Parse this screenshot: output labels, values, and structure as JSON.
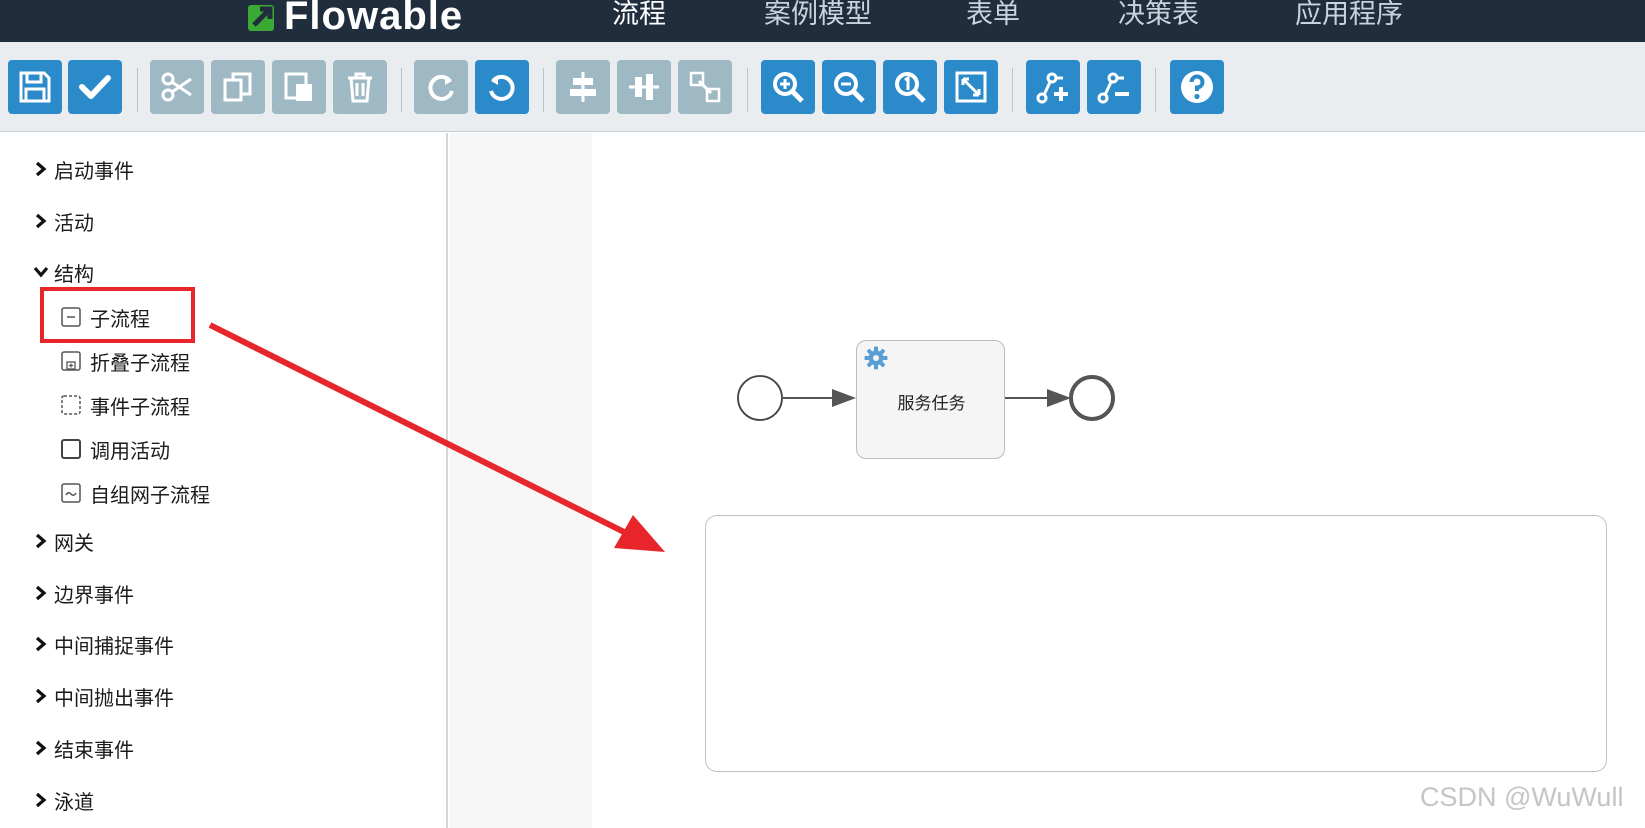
{
  "app": {
    "logo_text": "Flowable"
  },
  "nav": {
    "items": [
      {
        "label": "流程",
        "active": true
      },
      {
        "label": "案例模型",
        "active": false
      },
      {
        "label": "表单",
        "active": false
      },
      {
        "label": "决策表",
        "active": false
      },
      {
        "label": "应用程序",
        "active": false
      }
    ]
  },
  "toolbar": {
    "buttons": [
      {
        "icon": "save-icon",
        "enabled": true
      },
      {
        "icon": "check-icon",
        "enabled": true
      },
      {
        "icon": "cut-icon",
        "enabled": false
      },
      {
        "icon": "copy-icon",
        "enabled": false
      },
      {
        "icon": "paste-icon",
        "enabled": false
      },
      {
        "icon": "delete-icon",
        "enabled": false
      },
      {
        "icon": "redo-icon",
        "enabled": false
      },
      {
        "icon": "undo-icon",
        "enabled": true
      },
      {
        "icon": "align-horizontal-icon",
        "enabled": false
      },
      {
        "icon": "align-vertical-icon",
        "enabled": false
      },
      {
        "icon": "same-size-icon",
        "enabled": false
      },
      {
        "icon": "zoom-in-icon",
        "enabled": true
      },
      {
        "icon": "zoom-out-icon",
        "enabled": true
      },
      {
        "icon": "zoom-actual-icon",
        "enabled": true
      },
      {
        "icon": "zoom-fit-icon",
        "enabled": true
      },
      {
        "icon": "add-bendpoint-icon",
        "enabled": true
      },
      {
        "icon": "remove-bendpoint-icon",
        "enabled": true
      },
      {
        "icon": "help-icon",
        "enabled": true
      }
    ],
    "colors": {
      "enabled": "#2b8ac9",
      "disabled": "#9fb9c4"
    }
  },
  "palette": {
    "groups": [
      {
        "label": "启动事件",
        "expanded": false
      },
      {
        "label": "活动",
        "expanded": false
      },
      {
        "label": "结构",
        "expanded": true
      },
      {
        "label": "网关",
        "expanded": false
      },
      {
        "label": "边界事件",
        "expanded": false
      },
      {
        "label": "中间捕捉事件",
        "expanded": false
      },
      {
        "label": "中间抛出事件",
        "expanded": false
      },
      {
        "label": "结束事件",
        "expanded": false
      },
      {
        "label": "泳道",
        "expanded": false
      }
    ],
    "structure_items": [
      {
        "label": "子流程",
        "icon": "subprocess-icon",
        "highlighted": true
      },
      {
        "label": "折叠子流程",
        "icon": "collapsed-subprocess-icon",
        "highlighted": false
      },
      {
        "label": "事件子流程",
        "icon": "event-subprocess-icon",
        "highlighted": false
      },
      {
        "label": "调用活动",
        "icon": "call-activity-icon",
        "highlighted": false
      },
      {
        "label": "自组网子流程",
        "icon": "adhoc-subprocess-icon",
        "highlighted": false
      }
    ]
  },
  "canvas": {
    "task_label": "服务任务",
    "task_icon": "gear-icon"
  },
  "annotation": {
    "color": "#e8252b"
  },
  "watermark": "CSDN @WuWull"
}
